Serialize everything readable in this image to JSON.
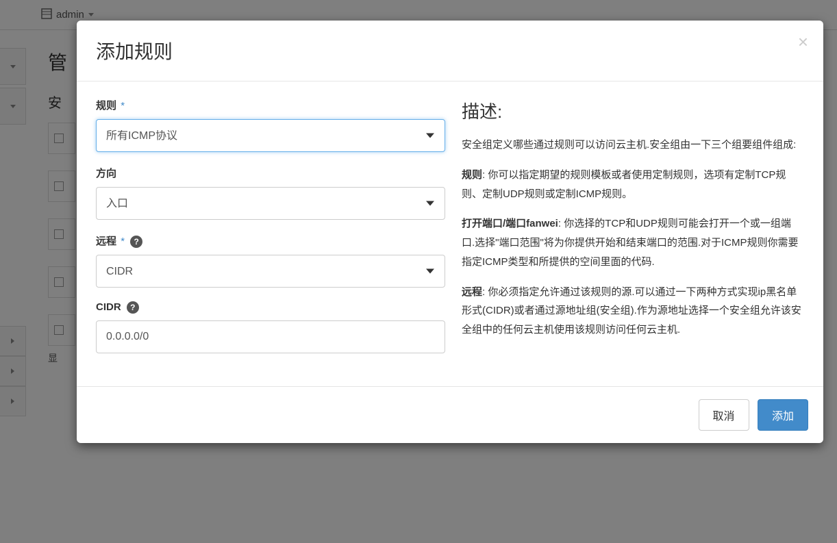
{
  "header": {
    "project_label": "admin"
  },
  "bg": {
    "title": "管",
    "subtitle": "安",
    "foot": "显"
  },
  "modal": {
    "title": "添加规则",
    "form": {
      "rule_label": "规则",
      "rule_value": "所有ICMP协议",
      "direction_label": "方向",
      "direction_value": "入口",
      "remote_label": "远程",
      "remote_value": "CIDR",
      "cidr_label": "CIDR",
      "cidr_value": "0.0.0.0/0"
    },
    "desc": {
      "title": "描述:",
      "intro": "安全组定义哪些通过规则可以访问云主机.安全组由一下三个组要组件组成:",
      "rule_label": "规则",
      "rule_text": ": 你可以指定期望的规则模板或者使用定制规则，选项有定制TCP规则、定制UDP规则或定制ICMP规则。",
      "port_label": "打开端口/端口fanwei",
      "port_text": ": 你选择的TCP和UDP规则可能会打开一个或一组端口.选择\"端口范围\"将为你提供开始和结束端口的范围.对于ICMP规则你需要指定ICMP类型和所提供的空间里面的代码.",
      "remote_label": "远程",
      "remote_text": ": 你必须指定允许通过该规则的源.可以通过一下两种方式实现ip黑名单形式(CIDR)或者通过源地址组(安全组).作为源地址选择一个安全组允许该安全组中的任何云主机使用该规则访问任何云主机."
    },
    "buttons": {
      "cancel": "取消",
      "submit": "添加"
    }
  }
}
